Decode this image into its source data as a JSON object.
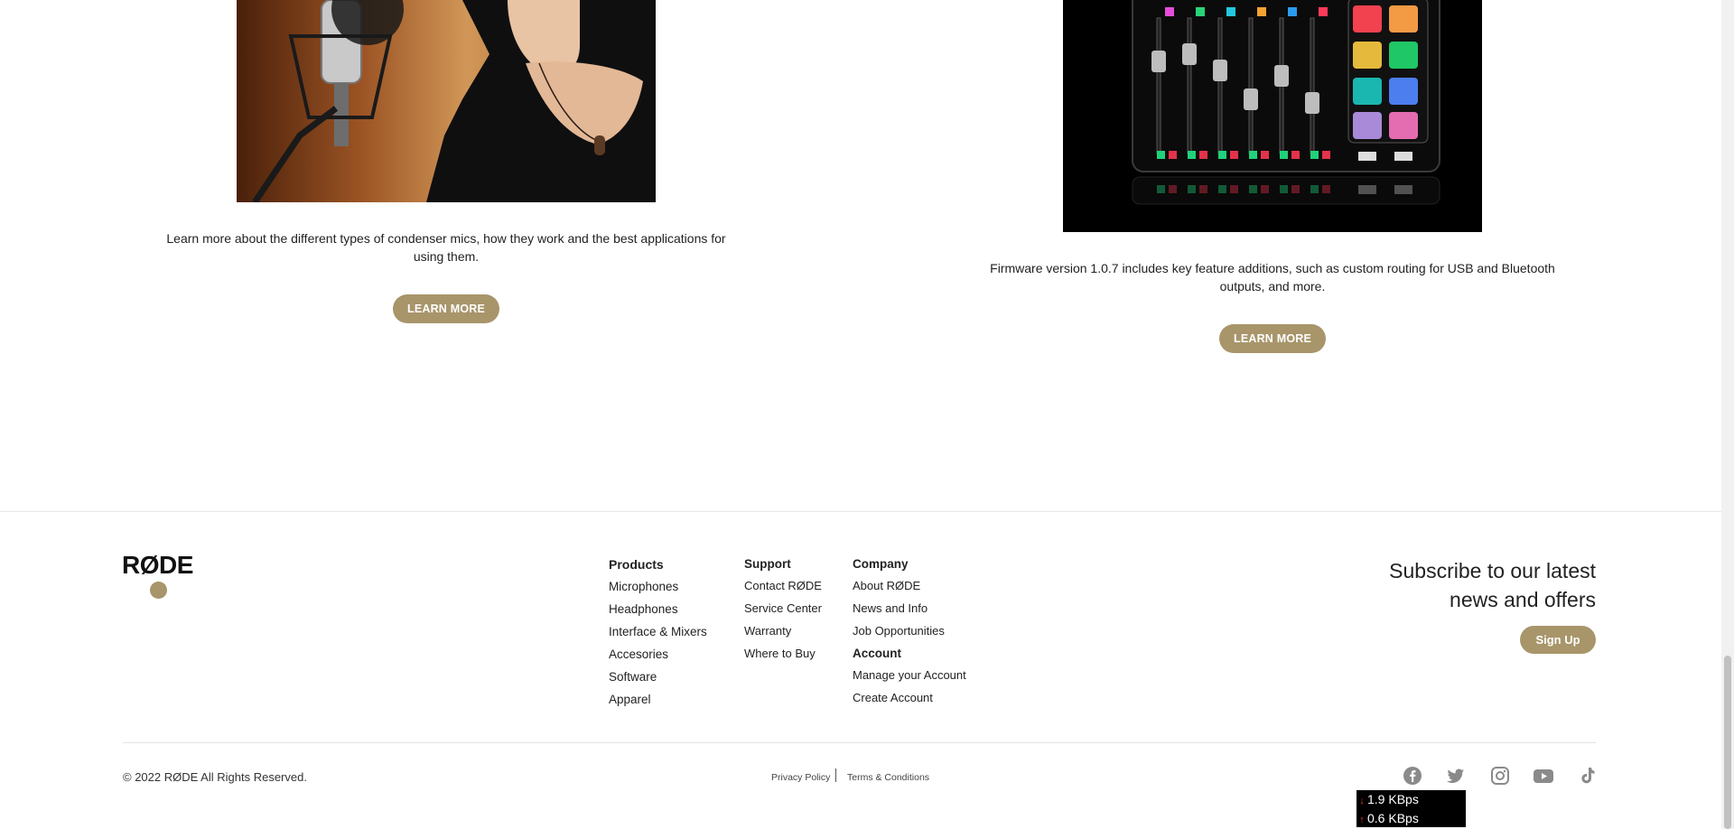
{
  "articles": [
    {
      "image_alt": "singer-condenser-mic-photo",
      "description": "Learn more about the different types of condenser mics, how they work and the best applications for using them.",
      "button": "LEARN MORE"
    },
    {
      "image_alt": "rodecaster-mixer-photo",
      "description": "Firmware version 1.0.7 includes key feature additions, such as custom routing for USB and Bluetooth outputs, and more.",
      "button": "LEARN MORE"
    }
  ],
  "footer": {
    "logo": "RØDE",
    "columns": {
      "products": {
        "heading": "Products",
        "links": [
          "Microphones",
          "Headphones",
          "Interface & Mixers",
          "Accesories",
          "Software",
          "Apparel"
        ]
      },
      "support": {
        "heading": "Support",
        "links": [
          "Contact RØDE",
          "Service Center",
          "Warranty",
          "Where to Buy"
        ]
      },
      "company": {
        "heading": "Company",
        "links": [
          "About RØDE",
          "News and Info",
          "Job Opportunities"
        ]
      },
      "account": {
        "heading": "Account",
        "links": [
          "Manage your Account",
          "Create Account"
        ]
      }
    },
    "subscribe": {
      "line1": "Subscribe to our latest",
      "line2": "news and offers",
      "button": "Sign Up"
    },
    "copyright": "© 2022 RØDE All Rights Reserved.",
    "legal": [
      "Privacy Policy",
      "Terms & Conditions"
    ],
    "social_icons": [
      "facebook-icon",
      "twitter-icon",
      "instagram-icon",
      "youtube-icon",
      "tiktok-icon"
    ]
  },
  "network_widget": {
    "download": "1.9 KBps",
    "upload": "0.6 KBps"
  },
  "colors": {
    "accent": "#a8956a",
    "text": "#222222"
  }
}
